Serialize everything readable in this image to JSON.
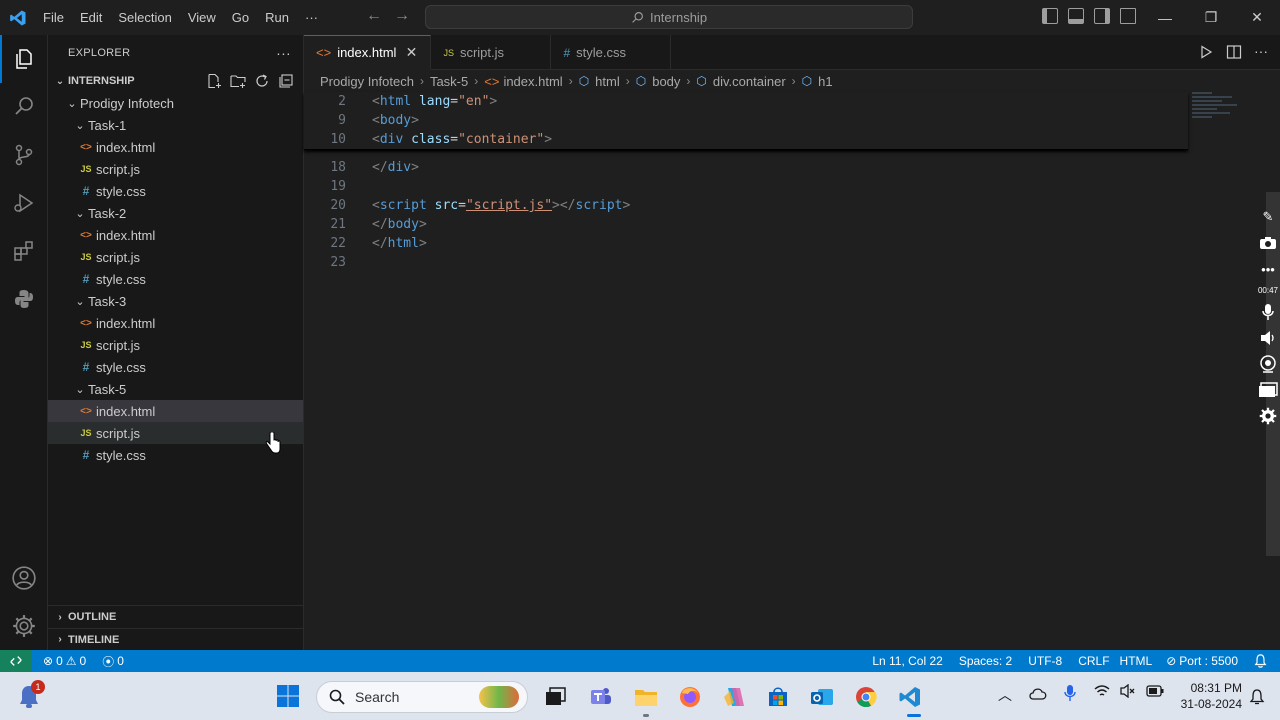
{
  "title_bar": {
    "menu": [
      "File",
      "Edit",
      "Selection",
      "View",
      "Go",
      "Run",
      "···"
    ],
    "command_center": "Internship"
  },
  "sidebar": {
    "header": "EXPLORER",
    "header_more": "···",
    "root": "INTERNSHIP",
    "folder": "Prodigy Infotech",
    "tree": [
      {
        "type": "folder",
        "label": "Task-1"
      },
      {
        "type": "html",
        "label": "index.html"
      },
      {
        "type": "js",
        "label": "script.js"
      },
      {
        "type": "css",
        "label": "style.css"
      },
      {
        "type": "folder",
        "label": "Task-2"
      },
      {
        "type": "html",
        "label": "index.html"
      },
      {
        "type": "js",
        "label": "script.js"
      },
      {
        "type": "css",
        "label": "style.css"
      },
      {
        "type": "folder",
        "label": "Task-3"
      },
      {
        "type": "html",
        "label": "index.html"
      },
      {
        "type": "js",
        "label": "script.js"
      },
      {
        "type": "css",
        "label": "style.css"
      },
      {
        "type": "folder",
        "label": "Task-5"
      },
      {
        "type": "html",
        "label": "index.html"
      },
      {
        "type": "js",
        "label": "script.js"
      },
      {
        "type": "css",
        "label": "style.css"
      }
    ],
    "file_icons": {
      "html": "<>",
      "js": "JS",
      "css": "#"
    },
    "outline": "OUTLINE",
    "timeline": "TIMELINE"
  },
  "tabs": [
    {
      "label": "index.html",
      "icon": "<>",
      "active": true
    },
    {
      "label": "script.js",
      "icon": "JS",
      "active": false
    },
    {
      "label": "style.css",
      "icon": "#",
      "active": false
    }
  ],
  "breadcrumb": [
    "Prodigy Infotech",
    "Task-5",
    "index.html",
    "html",
    "body",
    "div.container",
    "h1"
  ],
  "editor": {
    "sticky_lines": [
      {
        "num": "2",
        "segments": [
          [
            "tag",
            "<"
          ],
          [
            "tname",
            "html"
          ],
          [
            "plain",
            " "
          ],
          [
            "attr",
            "lang"
          ],
          [
            "plain",
            "="
          ],
          [
            "str",
            "\"en\""
          ],
          [
            "tag",
            ">"
          ]
        ]
      },
      {
        "num": "9",
        "segments": [
          [
            "tag",
            "<"
          ],
          [
            "tname",
            "body"
          ],
          [
            "tag",
            ">"
          ]
        ]
      },
      {
        "num": "10",
        "segments": [
          [
            "tag",
            "<"
          ],
          [
            "tname",
            "div"
          ],
          [
            "plain",
            " "
          ],
          [
            "attr",
            "class"
          ],
          [
            "plain",
            "="
          ],
          [
            "str",
            "\"container\""
          ],
          [
            "tag",
            ">"
          ]
        ]
      }
    ],
    "lines": [
      {
        "num": "18",
        "segments": [
          [
            "tag",
            "</"
          ],
          [
            "tname",
            "div"
          ],
          [
            "tag",
            ">"
          ]
        ]
      },
      {
        "num": "19",
        "segments": []
      },
      {
        "num": "20",
        "segments": [
          [
            "tag",
            "<"
          ],
          [
            "tname",
            "script"
          ],
          [
            "plain",
            " "
          ],
          [
            "attr",
            "src"
          ],
          [
            "plain",
            "="
          ],
          [
            "str",
            "\"script.js\""
          ],
          [
            "tag",
            "></"
          ],
          [
            "tname",
            "script"
          ],
          [
            "tag",
            ">"
          ]
        ]
      },
      {
        "num": "21",
        "segments": [
          [
            "tag",
            "</"
          ],
          [
            "tname",
            "body"
          ],
          [
            "tag",
            ">"
          ]
        ]
      },
      {
        "num": "22",
        "segments": [
          [
            "tag",
            "</"
          ],
          [
            "tname",
            "html"
          ],
          [
            "tag",
            ">"
          ]
        ]
      },
      {
        "num": "23",
        "segments": []
      }
    ]
  },
  "overlay": {
    "time": "00:47"
  },
  "status_bar": {
    "errors": "0",
    "warnings": "0",
    "ports": "0",
    "position": "Ln 11, Col 22",
    "spaces": "Spaces: 2",
    "encoding": "UTF-8",
    "eol": "CRLF",
    "language": "HTML",
    "port": "Port : 5500"
  },
  "taskbar": {
    "search_placeholder": "Search",
    "notification_count": "1",
    "time": "08:31 PM",
    "date": "31-08-2024"
  },
  "colors": {
    "accent": "#0078d4",
    "statusbar": "#007acc",
    "editor_bg": "#1f1f1f",
    "sidebar_bg": "#181818"
  }
}
